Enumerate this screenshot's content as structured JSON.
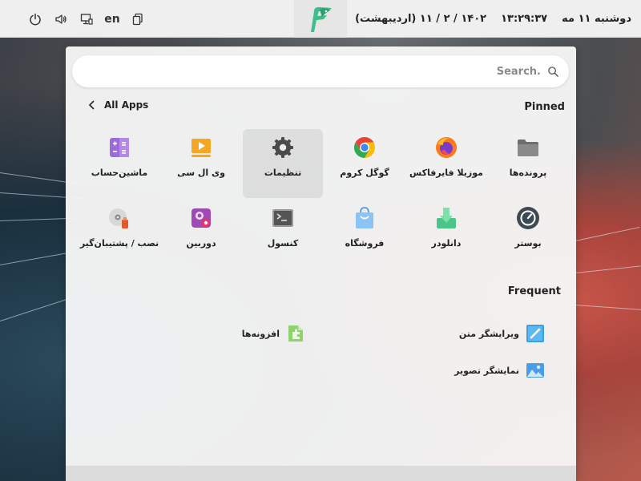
{
  "topbar": {
    "keyboard_layout": "en",
    "clock": {
      "day": "دوشنبه ۱۱ مه",
      "time": "۱۳:۲۹:۳۷",
      "date": "۱۴۰۲ / ۲ / ۱۱ (اردیبهشت)"
    }
  },
  "menu": {
    "search": {
      "placeholder": "Search.",
      "value": ""
    },
    "pinned_title": "Pinned",
    "all_apps_label": "All Apps",
    "pinned": [
      {
        "label": "پرونده‌ها",
        "icon": "folder-icon"
      },
      {
        "label": "موزیلا فایرفاکس",
        "icon": "firefox-icon"
      },
      {
        "label": "گوگل کروم",
        "icon": "chrome-icon"
      },
      {
        "label": "تنظیمات",
        "icon": "settings-gear-icon"
      },
      {
        "label": "وی ال سی",
        "icon": "vlc-player-icon"
      },
      {
        "label": "ماشین‌حساب",
        "icon": "calculator-icon"
      },
      {
        "label": "بوستر",
        "icon": "booster-gauge-icon"
      },
      {
        "label": "دانلودر",
        "icon": "download-icon"
      },
      {
        "label": "فروشگاه",
        "icon": "store-bag-icon"
      },
      {
        "label": "کنسول",
        "icon": "terminal-icon"
      },
      {
        "label": "دوربین",
        "icon": "camera-icon"
      },
      {
        "label": "نصب / پشتیبان‌گیر",
        "icon": "disk-backup-icon"
      }
    ],
    "frequent_title": "Frequent",
    "frequent": [
      {
        "label": "ویرایشگر متن",
        "icon": "text-editor-icon"
      },
      {
        "label": "افزونه‌ها",
        "icon": "extensions-puzzle-icon"
      },
      {
        "label": "نمایشگر تصویر",
        "icon": "image-viewer-icon"
      }
    ]
  }
}
